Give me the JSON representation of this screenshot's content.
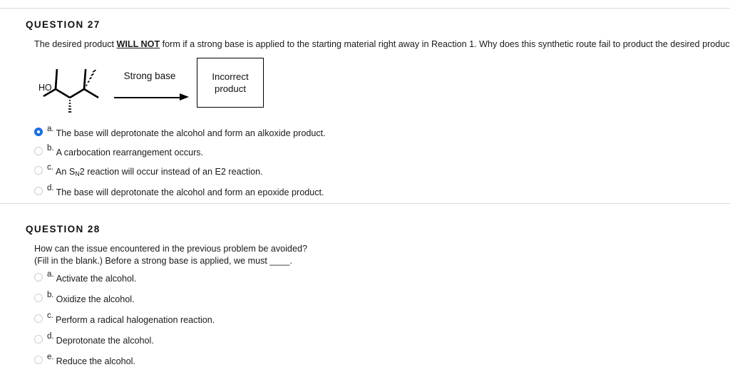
{
  "questions": [
    {
      "heading": "QUESTION 27",
      "body_prefix": "The desired product ",
      "body_emphasis": "WILL NOT",
      "body_suffix": " form if a strong base is applied to the starting material right away in Reaction 1. Why does this synthetic route fail to product the desired product?",
      "scheme": {
        "reagent_label": "Strong base",
        "structure_label": "HO",
        "product_box_line1": "Incorrect",
        "product_box_line2": "product"
      },
      "options": [
        {
          "letter": "a.",
          "text": "The base will deprotonate the alcohol and form an alkoxide product.",
          "selected": true
        },
        {
          "letter": "b.",
          "text": "A carbocation rearrangement occurs.",
          "selected": false
        },
        {
          "letter": "c.",
          "text_before_sub": "An S",
          "sub": "N",
          "text_after_sub": "2 reaction will occur instead of an E2 reaction.",
          "selected": false
        },
        {
          "letter": "d.",
          "text": "The base will deprotonate the alcohol and form an epoxide product.",
          "selected": false
        }
      ]
    },
    {
      "heading": "QUESTION 28",
      "body_line1": "How can the issue encountered in the previous problem be avoided?",
      "body_line2": "(Fill in the blank.) Before a strong base is applied, we must ____.",
      "options": [
        {
          "letter": "a.",
          "text": "Activate the alcohol.",
          "selected": false
        },
        {
          "letter": "b.",
          "text": "Oxidize the alcohol.",
          "selected": false
        },
        {
          "letter": "c.",
          "text": "Perform a radical halogenation reaction.",
          "selected": false
        },
        {
          "letter": "d.",
          "text": "Deprotonate the alcohol.",
          "selected": false
        },
        {
          "letter": "e.",
          "text": "Reduce the alcohol.",
          "selected": false
        }
      ]
    }
  ],
  "colors": {
    "selected_radio": "#1a73e8",
    "divider": "#d8d8d8",
    "text": "#1a1a1a"
  }
}
